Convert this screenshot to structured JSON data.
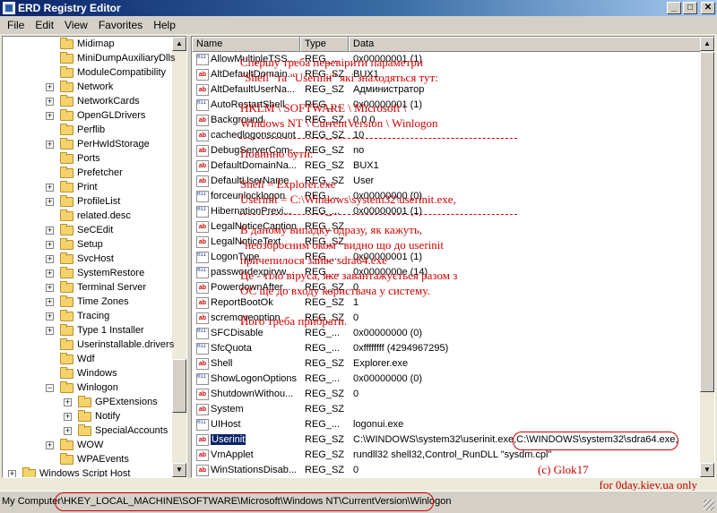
{
  "window": {
    "title": "ERD Registry Editor",
    "buttons": {
      "minimize": "_",
      "maximize": "□",
      "close": "✕"
    }
  },
  "menu": [
    "File",
    "Edit",
    "View",
    "Favorites",
    "Help"
  ],
  "tree": {
    "items": [
      {
        "label": "Midimap",
        "expandable": false
      },
      {
        "label": "MiniDumpAuxiliaryDlls",
        "expandable": false
      },
      {
        "label": "ModuleCompatibility",
        "expandable": false
      },
      {
        "label": "Network",
        "expandable": true
      },
      {
        "label": "NetworkCards",
        "expandable": true
      },
      {
        "label": "OpenGLDrivers",
        "expandable": true
      },
      {
        "label": "Perflib",
        "expandable": false
      },
      {
        "label": "PerHwIdStorage",
        "expandable": true
      },
      {
        "label": "Ports",
        "expandable": false
      },
      {
        "label": "Prefetcher",
        "expandable": false
      },
      {
        "label": "Print",
        "expandable": true
      },
      {
        "label": "ProfileList",
        "expandable": true
      },
      {
        "label": "related.desc",
        "expandable": false
      },
      {
        "label": "SeCEdit",
        "expandable": true
      },
      {
        "label": "Setup",
        "expandable": true
      },
      {
        "label": "SvcHost",
        "expandable": true
      },
      {
        "label": "SystemRestore",
        "expandable": true
      },
      {
        "label": "Terminal Server",
        "expandable": true
      },
      {
        "label": "Time Zones",
        "expandable": true
      },
      {
        "label": "Tracing",
        "expandable": true
      },
      {
        "label": "Type 1 Installer",
        "expandable": true
      },
      {
        "label": "Userinstallable.drivers",
        "expandable": false
      },
      {
        "label": "Wdf",
        "expandable": false
      },
      {
        "label": "Windows",
        "expandable": false
      },
      {
        "label": "Winlogon",
        "expandable": true,
        "expanded": true
      },
      {
        "label": "GPExtensions",
        "expandable": true,
        "child": true
      },
      {
        "label": "Notify",
        "expandable": true,
        "child": true
      },
      {
        "label": "SpecialAccounts",
        "expandable": true,
        "child": true
      },
      {
        "label": "WOW",
        "expandable": true
      },
      {
        "label": "WPAEvents",
        "expandable": false
      },
      {
        "label": "Windows Script Host",
        "expandable": true,
        "root": true
      }
    ]
  },
  "list": {
    "columns": [
      "Name",
      "Type",
      "Data"
    ],
    "rows": [
      {
        "name": "AllowMultipleTSS...",
        "type": "REG_...",
        "data": "0x00000001 (1)",
        "icon": "bin"
      },
      {
        "name": "AltDefaultDomain...",
        "type": "REG_SZ",
        "data": "BUX1",
        "icon": "ab"
      },
      {
        "name": "AltDefaultUserNa...",
        "type": "REG_SZ",
        "data": "Администратор",
        "icon": "ab"
      },
      {
        "name": "AutoRestartShell",
        "type": "REG_...",
        "data": "0x00000001 (1)",
        "icon": "bin"
      },
      {
        "name": "Background",
        "type": "REG_SZ",
        "data": "0 0 0",
        "icon": "ab"
      },
      {
        "name": "cachedlogonscount",
        "type": "REG_SZ",
        "data": "10",
        "icon": "ab"
      },
      {
        "name": "DebugServerCom...",
        "type": "REG_SZ",
        "data": "no",
        "icon": "ab"
      },
      {
        "name": "DefaultDomainNa...",
        "type": "REG_SZ",
        "data": "BUX1",
        "icon": "ab"
      },
      {
        "name": "DefaultUserName",
        "type": "REG_SZ",
        "data": "User",
        "icon": "ab"
      },
      {
        "name": "forceunlocklogon",
        "type": "REG_...",
        "data": "0x00000000 (0)",
        "icon": "bin"
      },
      {
        "name": "HibernationPrevi...",
        "type": "REG_...",
        "data": "0x00000001 (1)",
        "icon": "bin"
      },
      {
        "name": "LegalNoticeCaption",
        "type": "REG_SZ",
        "data": "",
        "icon": "ab"
      },
      {
        "name": "LegalNoticeText",
        "type": "REG_SZ",
        "data": "",
        "icon": "ab"
      },
      {
        "name": "LogonType",
        "type": "REG_...",
        "data": "0x00000001 (1)",
        "icon": "bin"
      },
      {
        "name": "passwordexpiryw...",
        "type": "REG_...",
        "data": "0x0000000e (14)",
        "icon": "bin"
      },
      {
        "name": "PowerdownAfter...",
        "type": "REG_SZ",
        "data": "0",
        "icon": "ab"
      },
      {
        "name": "ReportBootOk",
        "type": "REG_SZ",
        "data": "1",
        "icon": "ab"
      },
      {
        "name": "scremoveoption",
        "type": "REG_SZ",
        "data": "0",
        "icon": "ab"
      },
      {
        "name": "SFCDisable",
        "type": "REG_...",
        "data": "0x00000000 (0)",
        "icon": "bin"
      },
      {
        "name": "SfcQuota",
        "type": "REG_...",
        "data": "0xffffffff (4294967295)",
        "icon": "bin"
      },
      {
        "name": "Shell",
        "type": "REG_SZ",
        "data": "Explorer.exe",
        "icon": "ab"
      },
      {
        "name": "ShowLogonOptions",
        "type": "REG_...",
        "data": "0x00000000 (0)",
        "icon": "bin"
      },
      {
        "name": "ShutdownWithou...",
        "type": "REG_SZ",
        "data": "0",
        "icon": "ab"
      },
      {
        "name": "System",
        "type": "REG_SZ",
        "data": "",
        "icon": "ab"
      },
      {
        "name": "UIHost",
        "type": "REG_...",
        "data": "logonui.exe",
        "icon": "bin"
      },
      {
        "name": "Userinit",
        "type": "REG_SZ",
        "data": "C:\\WINDOWS\\system32\\userinit.exe,C:\\WINDOWS\\system32\\sdra64.exe,",
        "icon": "ab",
        "selected": true
      },
      {
        "name": "VmApplet",
        "type": "REG_SZ",
        "data": "rundll32 shell32,Control_RunDLL \"sysdm.cpl\"",
        "icon": "ab"
      },
      {
        "name": "WinStationsDisab...",
        "type": "REG_SZ",
        "data": "0",
        "icon": "ab"
      }
    ]
  },
  "annotation": {
    "lines": [
      "Спершу треба перевірити параметри",
      "\"Shell\" та \"Userinit\" які знаходяться тут:",
      "",
      "HKLM \\ SOFTWARE \\ Microsoft \\",
      "Windows NT \\ CurrentVersion \\ Winlogon",
      "",
      "Повинно бути:",
      "",
      "Shell = Explorer.exe",
      "Userinit = C:\\Windows\\system32\\userinit.exe,",
      "",
      "В даному випадку одразу, як кажуть,",
      "\"неозброєним оком\" видно що до userinit",
      "причепилося зайве sdra64.exe",
      "Це - тіло віруса, яке завантажується разом з",
      "ОС ще до входу користвача у систему.",
      "",
      "Його треба прибрати."
    ],
    "credit_1": "(c) Glok17",
    "credit_2": "for 0day.kiev.ua only"
  },
  "status": {
    "root": "My Computer",
    "path": "HKEY_LOCAL_MACHINE\\SOFTWARE\\Microsoft\\Windows NT\\CurrentVersion\\Winlogon"
  },
  "colors": {
    "annotation": "#d00000",
    "selection": "#0a246a",
    "title_gradient_start": "#0a246a"
  }
}
